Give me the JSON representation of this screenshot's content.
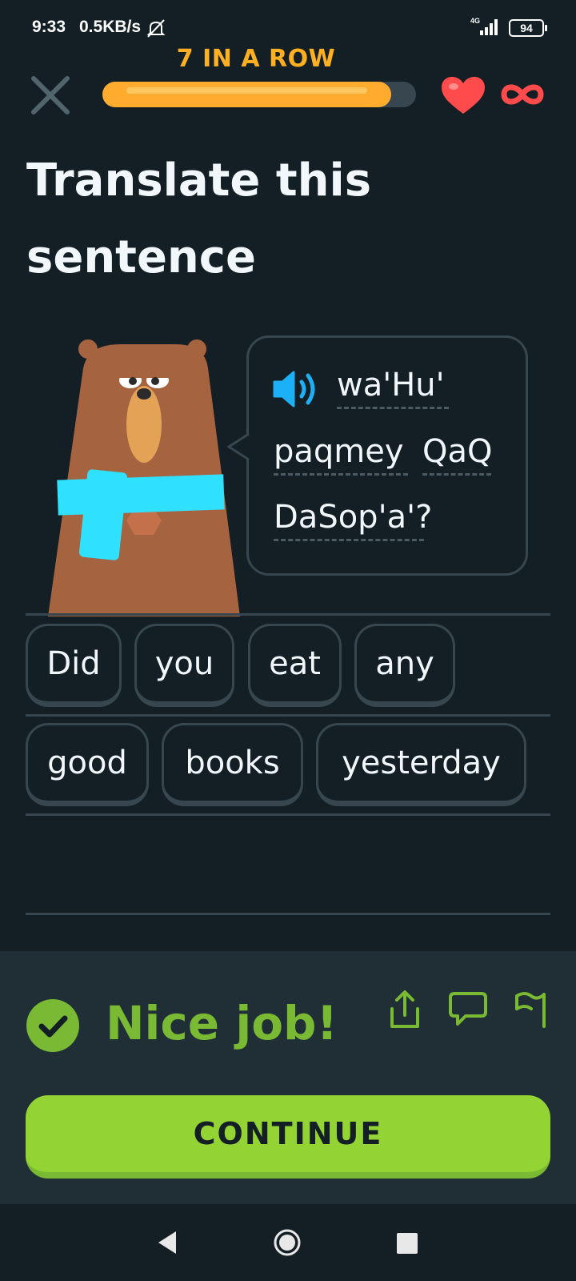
{
  "status_bar": {
    "time": "9:33",
    "speed": "0.5KB/s",
    "network": "4G",
    "battery": "94"
  },
  "header": {
    "streak_label": "7 IN A ROW",
    "progress_fraction": 0.92,
    "hearts": "∞"
  },
  "prompt": {
    "title": "Translate this sentence"
  },
  "sentence": {
    "tokens": [
      "wa'Hu'",
      "paqmey",
      "QaQ",
      "DaSop'a'?"
    ]
  },
  "word_bank": [
    "Did",
    "you",
    "eat",
    "any",
    "good",
    "books",
    "yesterday"
  ],
  "feedback": {
    "message": "Nice job!",
    "continue_label": "CONTINUE"
  },
  "colors": {
    "background": "#131f24",
    "streak": "#ffb020",
    "heart": "#ff4b4b",
    "success": "#79b933",
    "continue": "#93d333",
    "speaker": "#1cb0f6"
  }
}
